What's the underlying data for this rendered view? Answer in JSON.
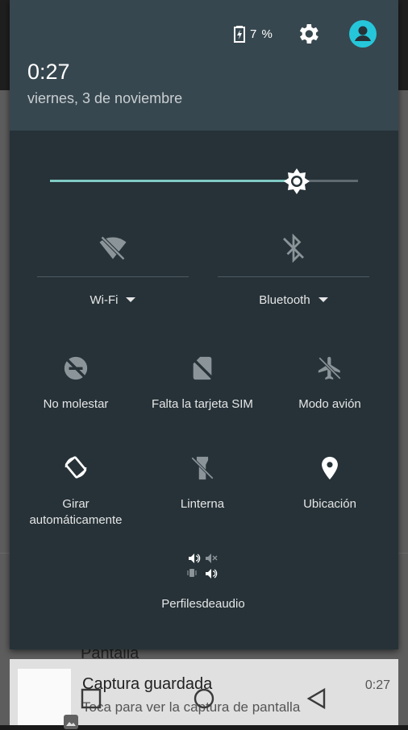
{
  "colors": {
    "panel": "#263238",
    "header": "#37474f",
    "accent": "#80cbc4",
    "text": "#ffffff"
  },
  "status": {
    "battery_icon": "battery-charging-icon",
    "battery_pct": "7 %",
    "settings_icon": "gear-icon",
    "user_icon": "account-icon"
  },
  "header": {
    "time": "0:27",
    "date": "viernes, 3 de noviembre"
  },
  "brightness": {
    "level": 0.8,
    "icon": "brightness-icon"
  },
  "tiles_dual": [
    {
      "label": "Wi-Fi",
      "icon": "wifi-off-icon"
    },
    {
      "label": "Bluetooth",
      "icon": "bluetooth-off-icon"
    }
  ],
  "tiles_row1": [
    {
      "label": "No molestar",
      "icon": "do-not-disturb-icon"
    },
    {
      "label": "Falta la tarjeta SIM",
      "icon": "sim-missing-icon"
    },
    {
      "label": "Modo avión",
      "icon": "airplane-off-icon"
    }
  ],
  "tiles_row2": [
    {
      "label_line1": "Girar",
      "label_line2": "automáticamente",
      "icon": "auto-rotate-icon"
    },
    {
      "label": "Linterna",
      "icon": "flashlight-off-icon"
    },
    {
      "label": "Ubicación",
      "icon": "location-icon"
    }
  ],
  "audio_profiles": {
    "label": "Perfilesdeaudio",
    "icon": "audio-profiles-icon"
  },
  "notification": {
    "title": "Captura guardada",
    "text": "Toca para ver la captura de pantalla",
    "time": "0:27"
  },
  "background": {
    "item": "Pantalla"
  }
}
